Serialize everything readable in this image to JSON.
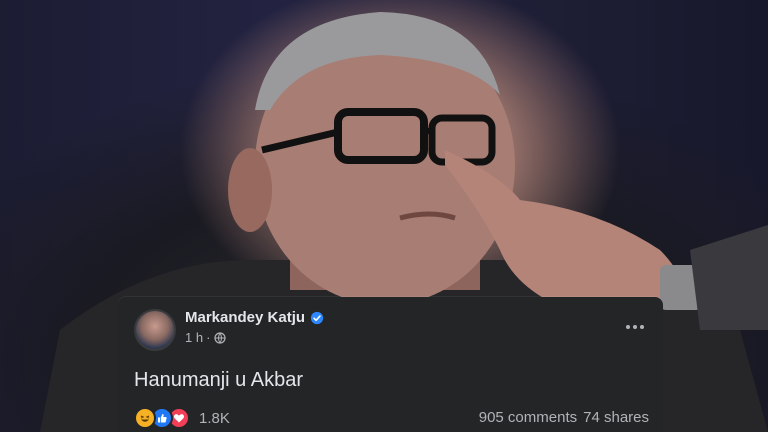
{
  "post": {
    "author_name": "Markandey Katju",
    "time_ago": "1 h",
    "separator": "·",
    "text": "Hanumanji u Akbar",
    "reaction_count": "1.8K",
    "comments": "905 comments",
    "shares": "74 shares",
    "reactions": [
      "haha-icon",
      "like-icon",
      "love-icon"
    ],
    "privacy_icon": "globe-icon",
    "verified_icon": "verified-badge-icon"
  },
  "colors": {
    "card_bg": "#242526",
    "text_primary": "#e4e6eb",
    "text_secondary": "#b0b3b8",
    "verified_blue": "#2d88ff",
    "like_blue": "#2078f4",
    "love_red": "#f33e58",
    "haha_yellow": "#f7b125"
  }
}
